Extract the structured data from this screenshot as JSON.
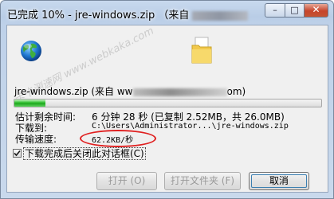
{
  "window": {
    "title": "已完成 10% - jre-windows.zip （来自",
    "minimize_glyph": "–",
    "maximize_glyph": "□",
    "close_glyph": "✕"
  },
  "watermark": "卡卡测速网 www.webkaka.com",
  "download": {
    "filename_prefix": "jre-windows.zip (来自 ww",
    "filename_suffix": "om)",
    "progress_percent": 10
  },
  "details": {
    "remaining_label": "估计剩余时间:",
    "remaining_value": "6 分钟 28 秒 (已复制 2.52MB，共 26.0MB)",
    "download_to_label": "下载到:",
    "download_to_value": "C:\\Users\\Administrator...\\jre-windows.zip",
    "rate_label": "传输速度:",
    "rate_value": "62.2KB/秒"
  },
  "close_on_complete": {
    "checked": true,
    "label": "下载完成后关闭此对话框(C)"
  },
  "buttons": {
    "open": "打开 (O)",
    "open_folder": "打开文件夹 (F)",
    "cancel": "取消"
  },
  "colors": {
    "progress_fill": "#2bbf2b",
    "annotation_circle": "#e02020"
  },
  "icons": {
    "file_type": "globe-icon",
    "destination": "folder-icon"
  }
}
